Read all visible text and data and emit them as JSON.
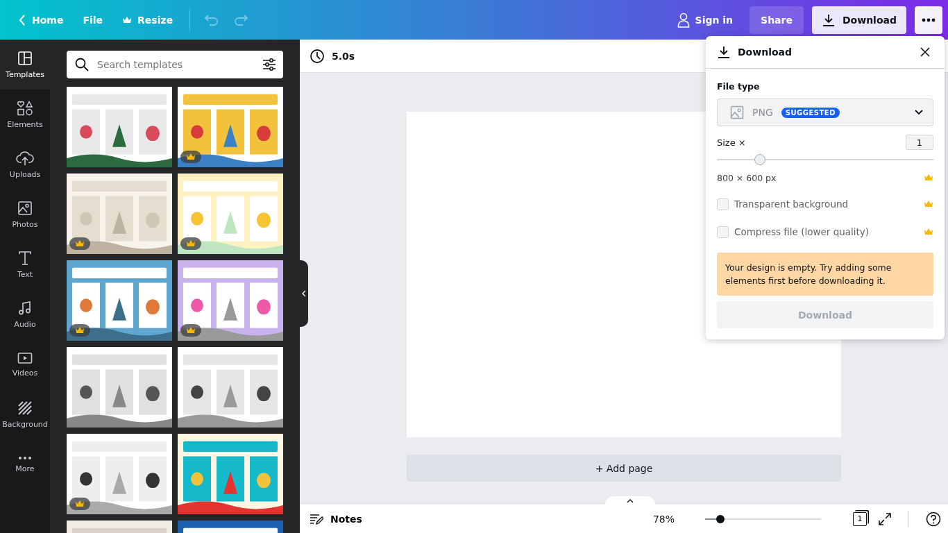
{
  "header": {
    "home": "Home",
    "file": "File",
    "resize": "Resize",
    "undo": {
      "disabled": true
    },
    "redo": {
      "disabled": true
    },
    "sign_in": "Sign in",
    "share": "Share",
    "download": "Download"
  },
  "sidebar": {
    "items": [
      {
        "label": "Templates",
        "kind": "templates",
        "selected": true
      },
      {
        "label": "Elements",
        "kind": "elements",
        "selected": false
      },
      {
        "label": "Uploads",
        "kind": "uploads",
        "selected": false
      },
      {
        "label": "Photos",
        "kind": "photos",
        "selected": false
      },
      {
        "label": "Text",
        "kind": "text",
        "selected": false
      },
      {
        "label": "Audio",
        "kind": "audio",
        "selected": false
      },
      {
        "label": "Videos",
        "kind": "videos",
        "selected": false
      },
      {
        "label": "Background",
        "kind": "background",
        "selected": false
      },
      {
        "label": "More",
        "kind": "more",
        "selected": false
      }
    ]
  },
  "templates_panel": {
    "search": {
      "placeholder": "Search templates"
    },
    "templates": [
      {
        "premium": false
      },
      {
        "premium": true
      },
      {
        "premium": true
      },
      {
        "premium": true
      },
      {
        "premium": true
      },
      {
        "premium": true
      },
      {
        "premium": false
      },
      {
        "premium": false
      },
      {
        "premium": true
      },
      {
        "premium": false
      },
      {
        "kind": "picture"
      },
      {
        "kind": "picture"
      }
    ]
  },
  "canvas": {
    "duration": "5.0s",
    "add_page": "+ Add page"
  },
  "download_panel": {
    "title": "Download",
    "file_type_label": "File type",
    "file_type": "PNG",
    "badge": "SUGGESTED",
    "size_label": "Size ×",
    "size_value": "1",
    "size": {
      "level": 0.2
    },
    "dimensions": "800 × 600 px",
    "dimensions_premium": true,
    "options": [
      {
        "label": "Transparent background",
        "checked": false,
        "premium": true
      },
      {
        "label": "Compress file (lower quality)",
        "checked": false,
        "premium": true
      }
    ],
    "warning": "Your design is empty. Try adding some elements first before downloading it.",
    "button": {
      "label": "Download",
      "disabled": true
    }
  },
  "footer": {
    "notes": "Notes",
    "zoom": "78%",
    "zoom_slider": {
      "level": 0.13
    },
    "page_count": "1"
  }
}
